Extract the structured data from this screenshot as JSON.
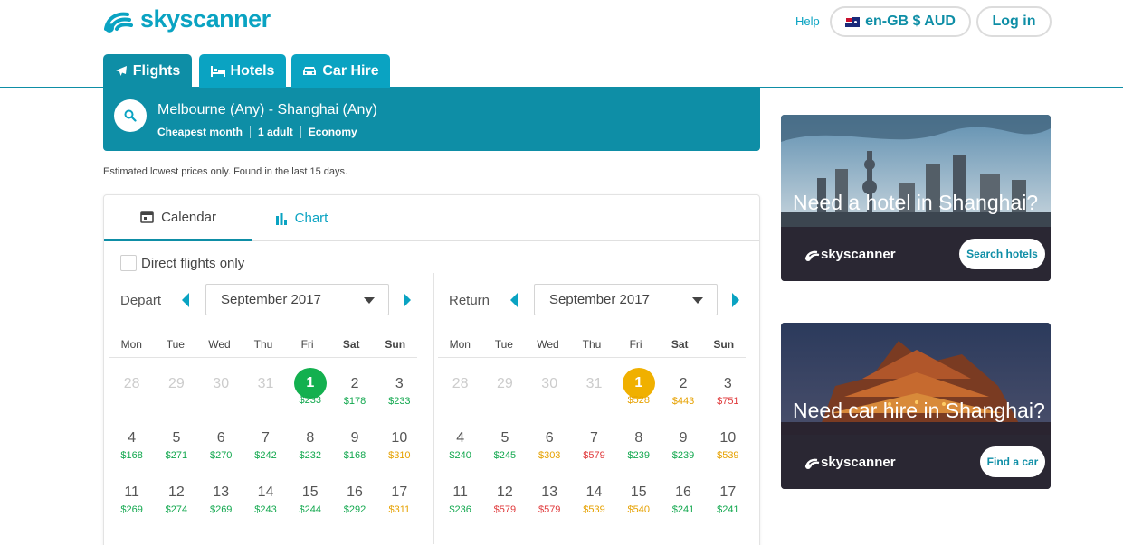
{
  "header": {
    "logo_text": "skyscanner",
    "help_label": "Help",
    "locale_label": "en-GB $ AUD",
    "login_label": "Log in"
  },
  "tabs": [
    {
      "label": "Flights",
      "icon": "plane-icon"
    },
    {
      "label": "Hotels",
      "icon": "bed-icon"
    },
    {
      "label": "Car Hire",
      "icon": "car-icon"
    }
  ],
  "search": {
    "route": "Melbourne (Any) - Shanghai (Any)",
    "meta": [
      "Cheapest month",
      "1 adult",
      "Economy"
    ]
  },
  "note": "Estimated lowest prices only. Found in the last 15 days.",
  "view_tabs": {
    "calendar": "Calendar",
    "chart": "Chart"
  },
  "direct_only_label": "Direct flights only",
  "depart": {
    "label": "Depart",
    "month": "September 2017"
  },
  "return": {
    "label": "Return",
    "month": "September 2017"
  },
  "weekdays": [
    "Mon",
    "Tue",
    "Wed",
    "Thu",
    "Fri",
    "Sat",
    "Sun"
  ],
  "depart_weeks": [
    [
      {
        "d": "28",
        "prev": true
      },
      {
        "d": "29",
        "prev": true
      },
      {
        "d": "30",
        "prev": true
      },
      {
        "d": "31",
        "prev": true
      },
      {
        "d": "1",
        "p": "$233",
        "c": "green",
        "sel": "green"
      },
      {
        "d": "2",
        "p": "$178",
        "c": "green"
      },
      {
        "d": "3",
        "p": "$233",
        "c": "green"
      }
    ],
    [
      {
        "d": "4",
        "p": "$168",
        "c": "green"
      },
      {
        "d": "5",
        "p": "$271",
        "c": "green"
      },
      {
        "d": "6",
        "p": "$270",
        "c": "green"
      },
      {
        "d": "7",
        "p": "$242",
        "c": "green"
      },
      {
        "d": "8",
        "p": "$232",
        "c": "green"
      },
      {
        "d": "9",
        "p": "$168",
        "c": "green"
      },
      {
        "d": "10",
        "p": "$310",
        "c": "orange"
      }
    ],
    [
      {
        "d": "11",
        "p": "$269",
        "c": "green"
      },
      {
        "d": "12",
        "p": "$274",
        "c": "green"
      },
      {
        "d": "13",
        "p": "$269",
        "c": "green"
      },
      {
        "d": "14",
        "p": "$243",
        "c": "green"
      },
      {
        "d": "15",
        "p": "$244",
        "c": "green"
      },
      {
        "d": "16",
        "p": "$292",
        "c": "green"
      },
      {
        "d": "17",
        "p": "$311",
        "c": "orange"
      }
    ]
  ],
  "return_weeks": [
    [
      {
        "d": "28",
        "prev": true
      },
      {
        "d": "29",
        "prev": true
      },
      {
        "d": "30",
        "prev": true
      },
      {
        "d": "31",
        "prev": true
      },
      {
        "d": "1",
        "p": "$528",
        "c": "orange",
        "sel": "yellow"
      },
      {
        "d": "2",
        "p": "$443",
        "c": "orange"
      },
      {
        "d": "3",
        "p": "$751",
        "c": "red"
      }
    ],
    [
      {
        "d": "4",
        "p": "$240",
        "c": "green"
      },
      {
        "d": "5",
        "p": "$245",
        "c": "green"
      },
      {
        "d": "6",
        "p": "$303",
        "c": "orange"
      },
      {
        "d": "7",
        "p": "$579",
        "c": "red"
      },
      {
        "d": "8",
        "p": "$239",
        "c": "green"
      },
      {
        "d": "9",
        "p": "$239",
        "c": "green"
      },
      {
        "d": "10",
        "p": "$539",
        "c": "orange"
      }
    ],
    [
      {
        "d": "11",
        "p": "$236",
        "c": "green"
      },
      {
        "d": "12",
        "p": "$579",
        "c": "red"
      },
      {
        "d": "13",
        "p": "$579",
        "c": "red"
      },
      {
        "d": "14",
        "p": "$539",
        "c": "orange"
      },
      {
        "d": "15",
        "p": "$540",
        "c": "orange"
      },
      {
        "d": "16",
        "p": "$241",
        "c": "green"
      },
      {
        "d": "17",
        "p": "$241",
        "c": "green"
      }
    ]
  ],
  "ads": {
    "hotel": {
      "title": "Need a hotel in Shanghai?",
      "logo": "skyscanner",
      "button": "Search hotels"
    },
    "car": {
      "title": "Need car hire in Shanghai?",
      "logo": "skyscanner",
      "button": "Find a car"
    }
  },
  "colors": {
    "brand": "#0aa3c2",
    "brand_dark": "#0e8ea6",
    "price_green": "#13a84f",
    "price_orange": "#e6a100",
    "price_red": "#e0393b"
  }
}
